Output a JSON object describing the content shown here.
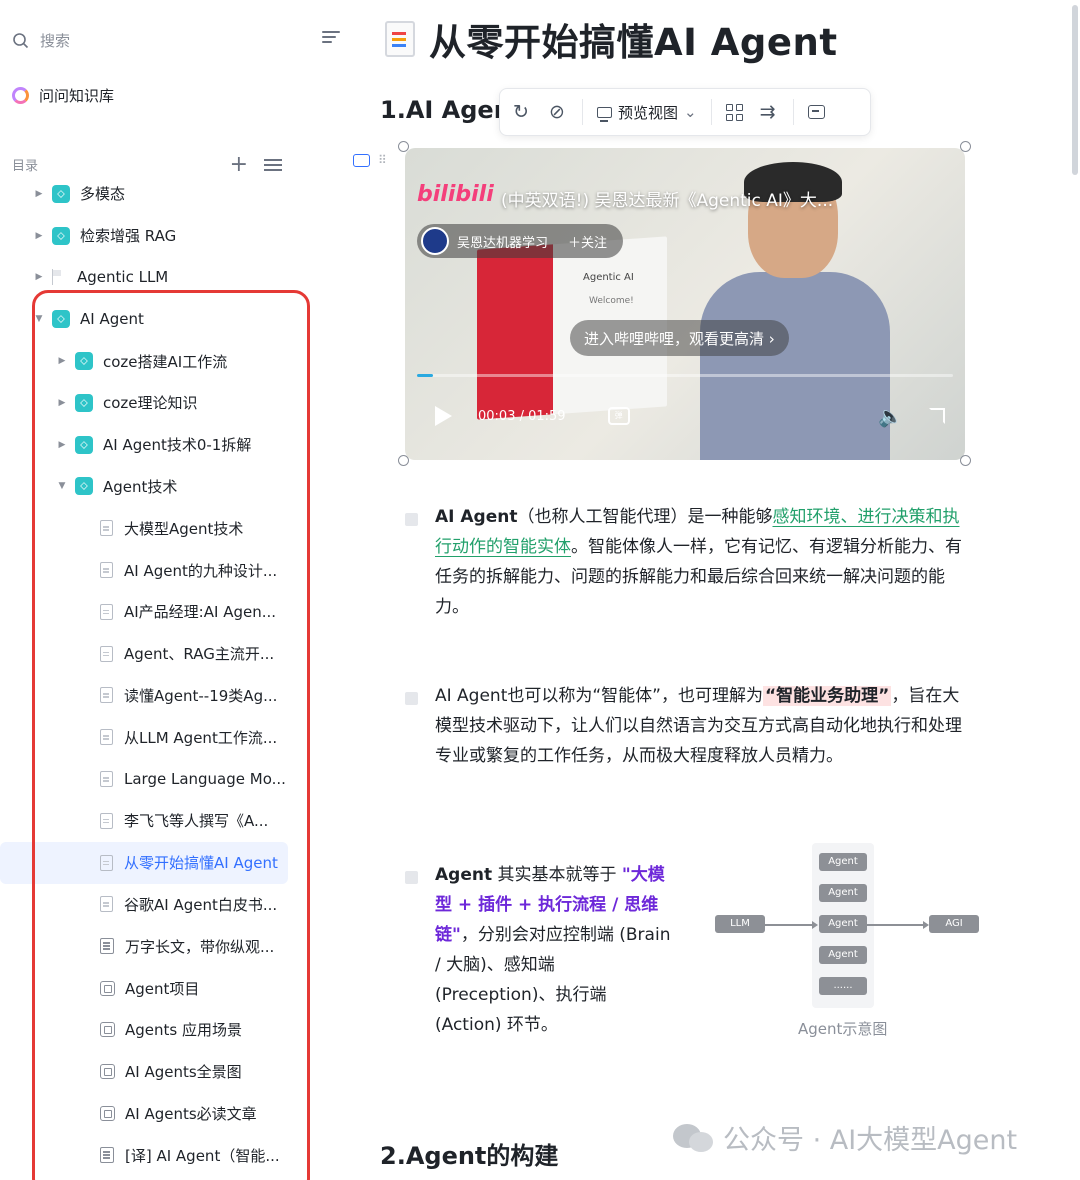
{
  "sidebar": {
    "search_placeholder": "搜索",
    "knowledge_base": "问问知识库",
    "toc_label": "目录",
    "items": [
      {
        "label": "多模态",
        "level": 1,
        "type": "folder",
        "caret": "right"
      },
      {
        "label": "检索增强 RAG",
        "level": 1,
        "type": "folder",
        "caret": "right"
      },
      {
        "label": "Agentic LLM",
        "level": 1,
        "type": "flag",
        "caret": "right"
      },
      {
        "label": "AI Agent",
        "level": 1,
        "type": "folder",
        "caret": "down"
      },
      {
        "label": "coze搭建AI工作流",
        "level": 2,
        "type": "folder",
        "caret": "right"
      },
      {
        "label": "coze理论知识",
        "level": 2,
        "type": "folder",
        "caret": "right"
      },
      {
        "label": "AI Agent技术0-1拆解",
        "level": 2,
        "type": "folder",
        "caret": "right"
      },
      {
        "label": "Agent技术",
        "level": 2,
        "type": "folder",
        "caret": "down"
      },
      {
        "label": "大模型Agent技术",
        "level": 3,
        "type": "doc"
      },
      {
        "label": "AI Agent的九种设计...",
        "level": 3,
        "type": "doc"
      },
      {
        "label": "AI产品经理:AI Agen...",
        "level": 3,
        "type": "doc"
      },
      {
        "label": "Agent、RAG主流开...",
        "level": 3,
        "type": "doc"
      },
      {
        "label": "读懂Agent--19类Ag...",
        "level": 3,
        "type": "doc"
      },
      {
        "label": "从LLM Agent工作流...",
        "level": 3,
        "type": "doc"
      },
      {
        "label": "Large Language Mo...",
        "level": 3,
        "type": "doc"
      },
      {
        "label": "李飞飞等人撰写《A...",
        "level": 3,
        "type": "doc"
      },
      {
        "label": "从零开始搞懂AI Agent",
        "level": 3,
        "type": "doc",
        "active": true
      },
      {
        "label": "谷歌AI Agent白皮书...",
        "level": 3,
        "type": "doc"
      },
      {
        "label": "万字长文，带你纵观...",
        "level": 3,
        "type": "lines"
      },
      {
        "label": "Agent项目",
        "level": 3,
        "type": "board"
      },
      {
        "label": "Agents 应用场景",
        "level": 3,
        "type": "board"
      },
      {
        "label": "AI Agents全景图",
        "level": 3,
        "type": "board"
      },
      {
        "label": "AI Agents必读文章",
        "level": 3,
        "type": "board"
      },
      {
        "label": "[译] AI Agent（智能...",
        "level": 3,
        "type": "lines"
      }
    ]
  },
  "main": {
    "title": "从零开始搞懂AI Agent",
    "section1": "1.AI Agen",
    "section2": "2.Agent的构建",
    "toolbar": {
      "preview_label": "预览视图",
      "refresh_glyph": "↻",
      "compass_glyph": "⊘",
      "chevron_glyph": "⌄",
      "wrap_glyph": "⇉"
    },
    "video": {
      "logo": "bilibili",
      "title": "(中英双语!) 吴恩达最新《Agentic AI》大...",
      "channel": "吴恩达机器学习",
      "follow": "＋关注",
      "panel_text": "Agentic AI",
      "panel_sub": "Welcome!",
      "open_label": "进入哔哩哔哩，观看更高清 ›",
      "time": "00:03 / 01:59",
      "progress": 0.03,
      "danmu": "弹"
    },
    "para1": {
      "bold": "AI Agent",
      "t1": "（也称人工智能代理）是一种能够",
      "green": "感知环境、进行决策和执行动作的智能实体",
      "t2": "。智能体像人一样，它有记忆、有逻辑分析能力、有任务的拆解能力、问题的拆解能力和最后综合回来统一解决问题的能力。"
    },
    "para2": {
      "t1": "AI Agent也可以称为“智能体”，也可理解为",
      "red": "“智能业务助理”",
      "t2": "，旨在大模型技术驱动下，让人们以自然语言为交互方式高自动化地执行和处理专业或繁复的工作任务，从而极大程度释放人员精力。"
    },
    "para3": {
      "bold": "Agent",
      "t1": " 其实基本就等于 ",
      "purple": "\"大模型 + 插件 + 执行流程 / 思维链\"",
      "t2": "，分别会对应控制端 (Brain / 大脑)、感知端 (Preception)、执行端 (Action) 环节。"
    },
    "diagram": {
      "left": "LLM",
      "right": "AGI",
      "nodes": [
        "Agent",
        "Agent",
        "Agent",
        "Agent",
        "......"
      ],
      "caption": "Agent示意图"
    },
    "watermark": "公众号 · AI大模型Agent"
  }
}
